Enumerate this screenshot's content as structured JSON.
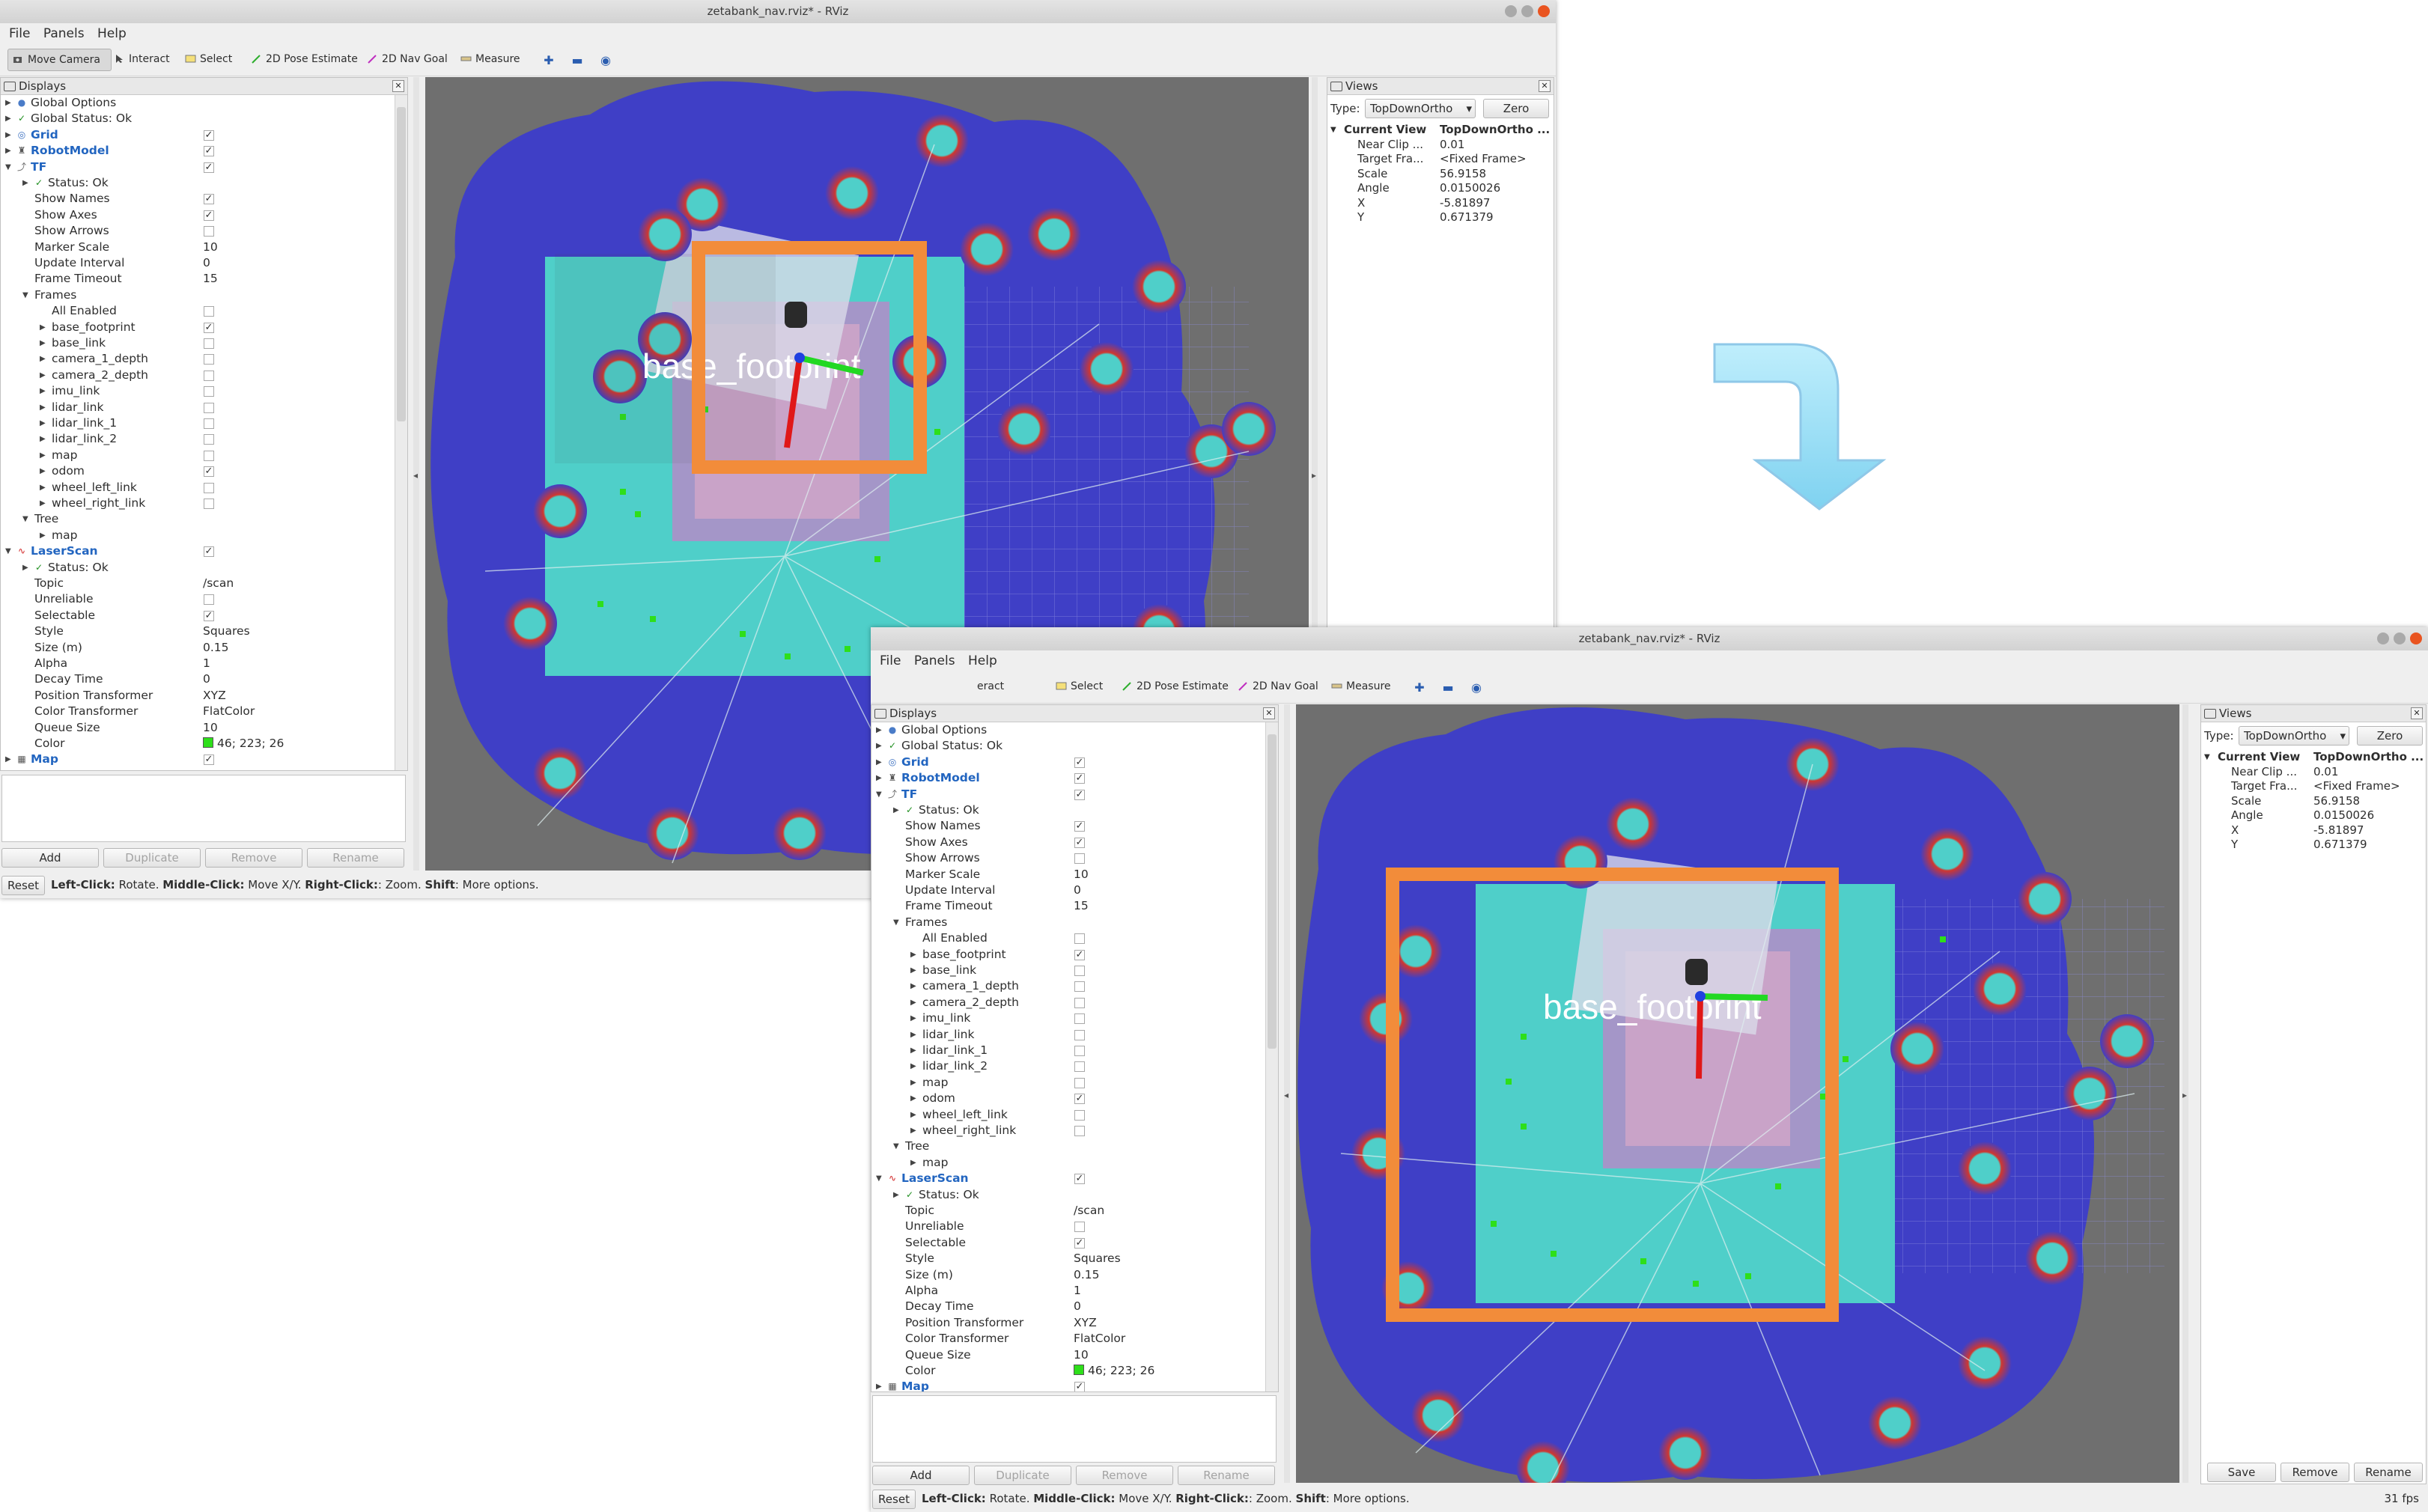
{
  "window": {
    "title": "zetabank_nav.rviz* - RViz",
    "menu": [
      "File",
      "Panels",
      "Help"
    ]
  },
  "toolbar": {
    "tools": [
      {
        "label": "Move Camera",
        "active": true
      },
      {
        "label": "Interact"
      },
      {
        "label": "Select"
      },
      {
        "label": "2D Pose Estimate"
      },
      {
        "label": "2D Nav Goal"
      },
      {
        "label": "Measure"
      }
    ],
    "tools_partial": {
      "interact": "eract"
    },
    "icons": [
      "plus-icon",
      "minus-icon",
      "eye-icon"
    ]
  },
  "displays": {
    "title": "Displays",
    "rows": [
      {
        "label": "Global Options",
        "value": "",
        "level": 0,
        "arrow": "right",
        "icon": "globe-icon",
        "check": null,
        "style": ""
      },
      {
        "label": "Global Status: Ok",
        "value": "",
        "level": 0,
        "arrow": "right",
        "icon": "check-icon",
        "check": null,
        "style": ""
      },
      {
        "label": "Grid",
        "value": "",
        "level": 0,
        "arrow": "right",
        "icon": "grid-icon",
        "check": true,
        "style": "blue"
      },
      {
        "label": "RobotModel",
        "value": "",
        "level": 0,
        "arrow": "right",
        "icon": "robot-icon",
        "check": true,
        "style": "blue"
      },
      {
        "label": "TF",
        "value": "",
        "level": 0,
        "arrow": "down",
        "icon": "tf-icon",
        "check": true,
        "style": "blue"
      },
      {
        "label": "Status: Ok",
        "value": "",
        "level": 1,
        "arrow": "right",
        "icon": "check-icon",
        "check": null,
        "style": ""
      },
      {
        "label": "Show Names",
        "value": "",
        "level": 1,
        "arrow": "",
        "icon": "",
        "check": true,
        "style": ""
      },
      {
        "label": "Show Axes",
        "value": "",
        "level": 1,
        "arrow": "",
        "icon": "",
        "check": true,
        "style": ""
      },
      {
        "label": "Show Arrows",
        "value": "",
        "level": 1,
        "arrow": "",
        "icon": "",
        "check": false,
        "style": ""
      },
      {
        "label": "Marker Scale",
        "value": "10",
        "level": 1,
        "arrow": "",
        "icon": "",
        "check": null,
        "style": ""
      },
      {
        "label": "Update Interval",
        "value": "0",
        "level": 1,
        "arrow": "",
        "icon": "",
        "check": null,
        "style": ""
      },
      {
        "label": "Frame Timeout",
        "value": "15",
        "level": 1,
        "arrow": "",
        "icon": "",
        "check": null,
        "style": ""
      },
      {
        "label": "Frames",
        "value": "",
        "level": 1,
        "arrow": "down",
        "icon": "",
        "check": null,
        "style": ""
      },
      {
        "label": "All Enabled",
        "value": "",
        "level": 2,
        "arrow": "",
        "icon": "",
        "check": false,
        "style": ""
      },
      {
        "label": "base_footprint",
        "value": "",
        "level": 2,
        "arrow": "right",
        "icon": "",
        "check": true,
        "style": ""
      },
      {
        "label": "base_link",
        "value": "",
        "level": 2,
        "arrow": "right",
        "icon": "",
        "check": false,
        "style": ""
      },
      {
        "label": "camera_1_depth",
        "value": "",
        "level": 2,
        "arrow": "right",
        "icon": "",
        "check": false,
        "style": ""
      },
      {
        "label": "camera_2_depth",
        "value": "",
        "level": 2,
        "arrow": "right",
        "icon": "",
        "check": false,
        "style": ""
      },
      {
        "label": "imu_link",
        "value": "",
        "level": 2,
        "arrow": "right",
        "icon": "",
        "check": false,
        "style": ""
      },
      {
        "label": "lidar_link",
        "value": "",
        "level": 2,
        "arrow": "right",
        "icon": "",
        "check": false,
        "style": ""
      },
      {
        "label": "lidar_link_1",
        "value": "",
        "level": 2,
        "arrow": "right",
        "icon": "",
        "check": false,
        "style": ""
      },
      {
        "label": "lidar_link_2",
        "value": "",
        "level": 2,
        "arrow": "right",
        "icon": "",
        "check": false,
        "style": ""
      },
      {
        "label": "map",
        "value": "",
        "level": 2,
        "arrow": "right",
        "icon": "",
        "check": false,
        "style": ""
      },
      {
        "label": "odom",
        "value": "",
        "level": 2,
        "arrow": "right",
        "icon": "",
        "check": true,
        "style": ""
      },
      {
        "label": "wheel_left_link",
        "value": "",
        "level": 2,
        "arrow": "right",
        "icon": "",
        "check": false,
        "style": ""
      },
      {
        "label": "wheel_right_link",
        "value": "",
        "level": 2,
        "arrow": "right",
        "icon": "",
        "check": false,
        "style": ""
      },
      {
        "label": "Tree",
        "value": "",
        "level": 1,
        "arrow": "down",
        "icon": "",
        "check": null,
        "style": ""
      },
      {
        "label": "map",
        "value": "",
        "level": 2,
        "arrow": "right",
        "icon": "",
        "check": null,
        "style": ""
      },
      {
        "label": "LaserScan",
        "value": "",
        "level": 0,
        "arrow": "down",
        "icon": "laser-icon",
        "check": true,
        "style": "blue"
      },
      {
        "label": "Status: Ok",
        "value": "",
        "level": 1,
        "arrow": "right",
        "icon": "check-icon",
        "check": null,
        "style": ""
      },
      {
        "label": "Topic",
        "value": "/scan",
        "level": 1,
        "arrow": "",
        "icon": "",
        "check": null,
        "style": ""
      },
      {
        "label": "Unreliable",
        "value": "",
        "level": 1,
        "arrow": "",
        "icon": "",
        "check": false,
        "style": ""
      },
      {
        "label": "Selectable",
        "value": "",
        "level": 1,
        "arrow": "",
        "icon": "",
        "check": true,
        "style": ""
      },
      {
        "label": "Style",
        "value": "Squares",
        "level": 1,
        "arrow": "",
        "icon": "",
        "check": null,
        "style": ""
      },
      {
        "label": "Size (m)",
        "value": "0.15",
        "level": 1,
        "arrow": "",
        "icon": "",
        "check": null,
        "style": ""
      },
      {
        "label": "Alpha",
        "value": "1",
        "level": 1,
        "arrow": "",
        "icon": "",
        "check": null,
        "style": ""
      },
      {
        "label": "Decay Time",
        "value": "0",
        "level": 1,
        "arrow": "",
        "icon": "",
        "check": null,
        "style": ""
      },
      {
        "label": "Position Transformer",
        "value": "XYZ",
        "level": 1,
        "arrow": "",
        "icon": "",
        "check": null,
        "style": ""
      },
      {
        "label": "Color Transformer",
        "value": "FlatColor",
        "level": 1,
        "arrow": "",
        "icon": "",
        "check": null,
        "style": ""
      },
      {
        "label": "Queue Size",
        "value": "10",
        "level": 1,
        "arrow": "",
        "icon": "",
        "check": null,
        "style": ""
      },
      {
        "label": "Color",
        "value": "46; 223; 26",
        "level": 1,
        "arrow": "",
        "icon": "",
        "check": null,
        "style": "",
        "swatch": "#2edf1a"
      },
      {
        "label": "Map",
        "value": "",
        "level": 0,
        "arrow": "right",
        "icon": "map-icon",
        "check": true,
        "style": "blue"
      }
    ],
    "buttons": {
      "add": "Add",
      "duplicate": "Duplicate",
      "remove": "Remove",
      "rename": "Rename"
    }
  },
  "views": {
    "title": "Views",
    "type_label": "Type:",
    "type_value": "TopDownOrtho",
    "zero": "Zero",
    "current_view": "Current View",
    "current_view_value": "TopDownOrtho ...",
    "props": [
      {
        "k": "Near Clip ...",
        "v": "0.01"
      },
      {
        "k": "Target Fra...",
        "v": "<Fixed Frame>"
      },
      {
        "k": "Scale",
        "v": "56.9158"
      },
      {
        "k": "Angle",
        "v": "0.0150026"
      },
      {
        "k": "X",
        "v": "-5.81897"
      },
      {
        "k": "Y",
        "v": "0.671379"
      }
    ],
    "buttons": {
      "save": "Save",
      "remove": "Remove",
      "rename": "Rename"
    }
  },
  "statusbar": {
    "reset": "Reset",
    "left_click": "Left-Click:",
    "rotate": " Rotate. ",
    "middle_click": "Middle-Click:",
    "move": " Move X/Y. ",
    "right_click": "Right-Click:",
    "zoom": ": Zoom. ",
    "shift": "Shift",
    "more": ": More options."
  },
  "viewport": {
    "frame_label": "base_footprint",
    "highlight_color": "#f28c3a"
  },
  "fps": "31 fps",
  "colors": {
    "map_background": "#6f6f6f",
    "costmap_blue": "#3f3fc6",
    "costmap_cyan": "#4fcfc9",
    "costmap_red": "#d0372f",
    "laser_green": "#2edf1a",
    "link_blue": "#2265c0"
  }
}
